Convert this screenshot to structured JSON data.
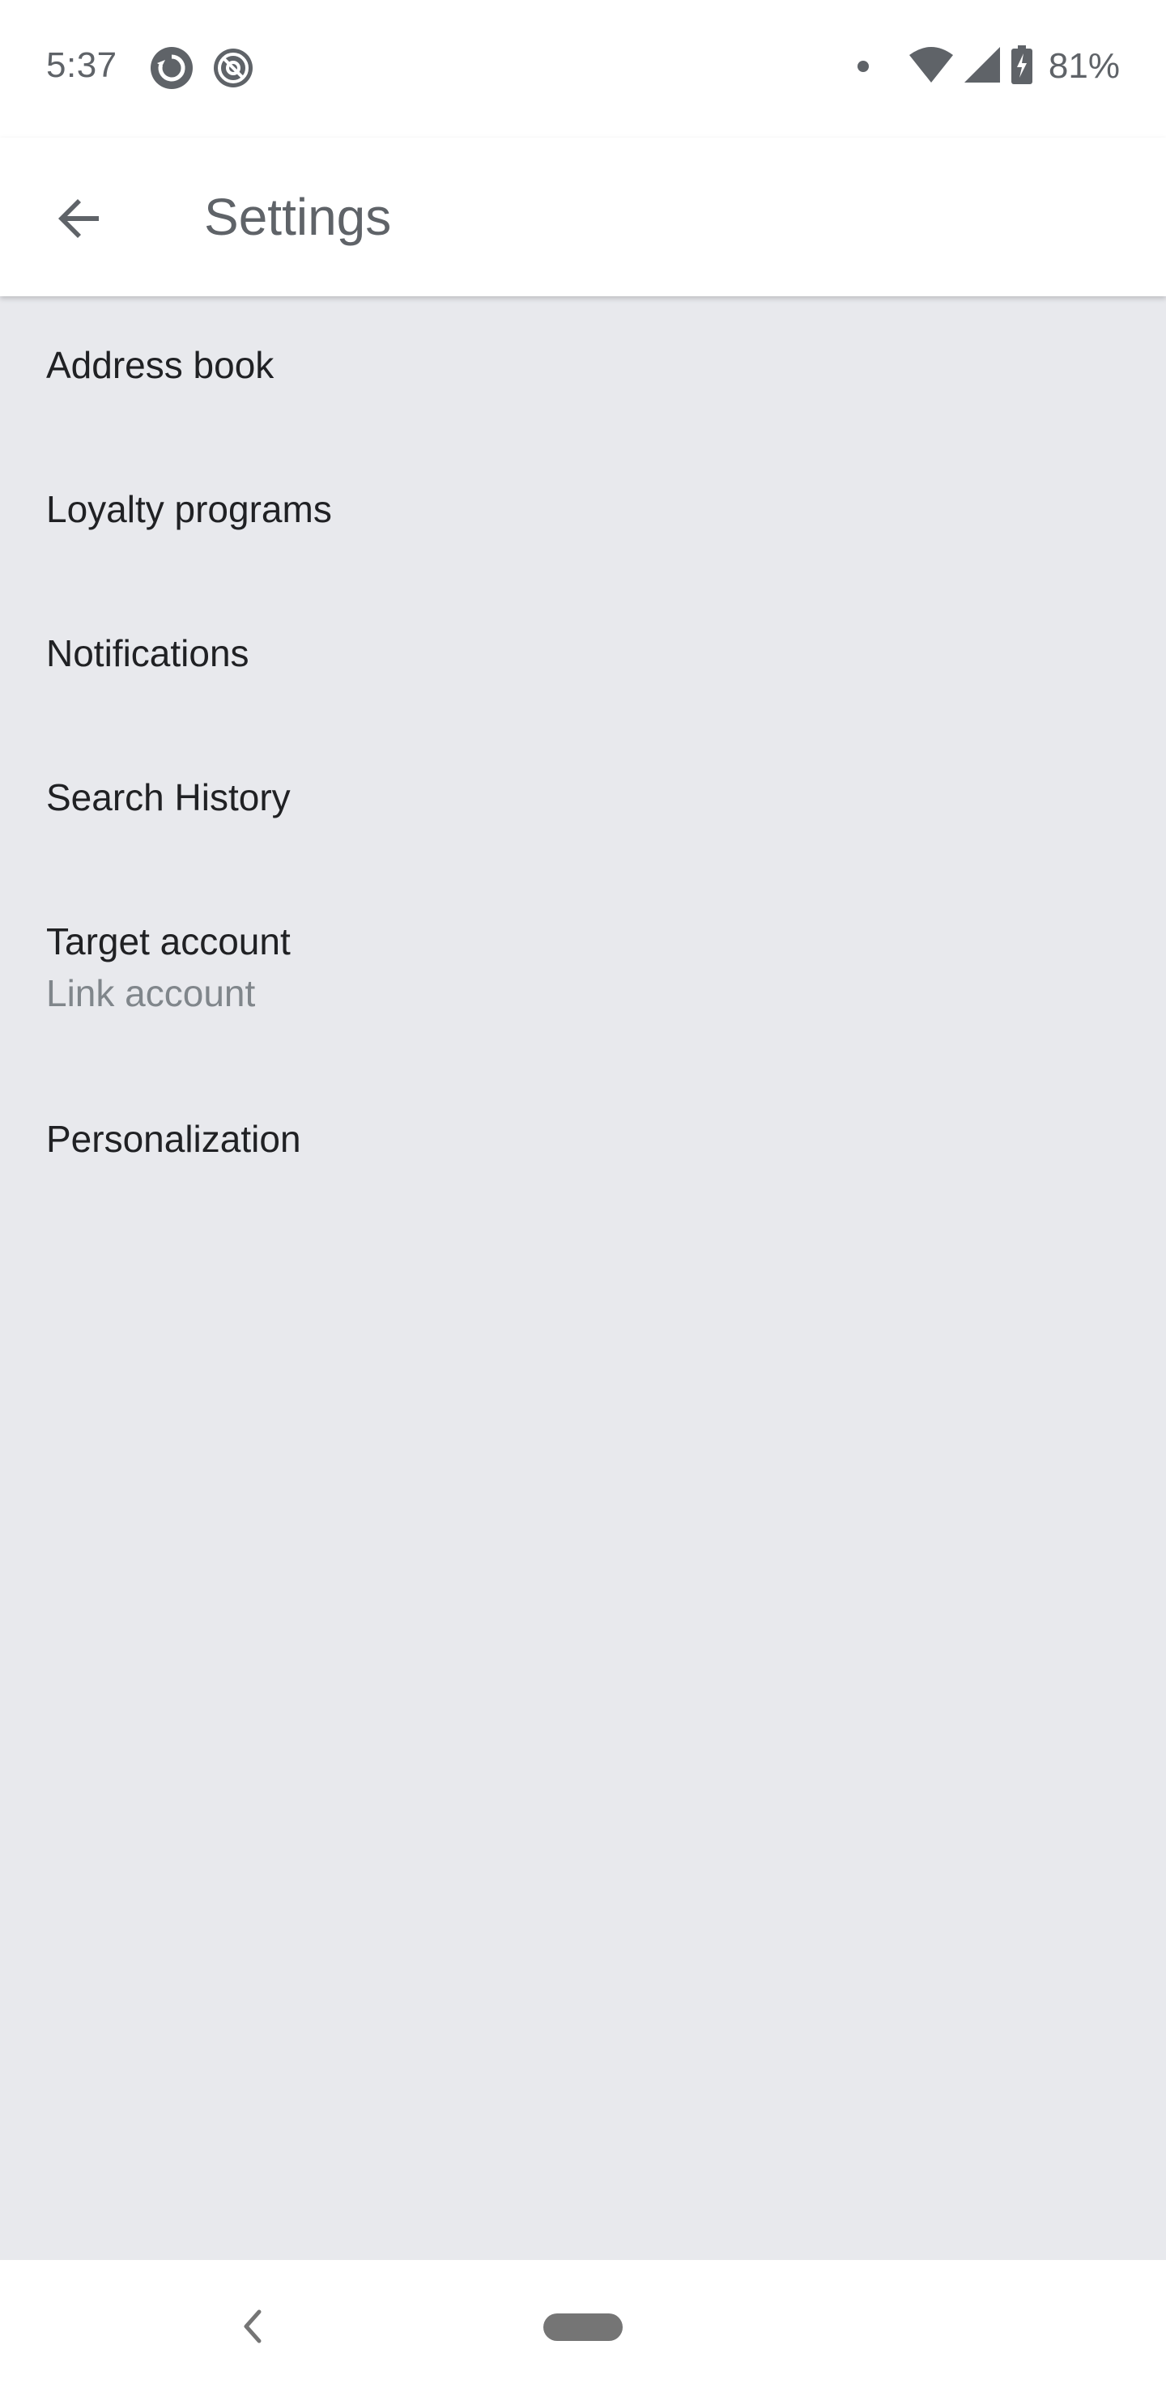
{
  "status_bar": {
    "time": "5:37",
    "notification_icons": [
      "sync-circle-icon",
      "at-sign-circle-icon"
    ],
    "indicators": [
      "dot-icon",
      "wifi-icon",
      "cellular-signal-icon",
      "battery-charging-icon"
    ],
    "battery_percent": "81%"
  },
  "app_bar": {
    "back_icon": "arrow-back-icon",
    "title": "Settings"
  },
  "settings": {
    "items": [
      {
        "label": "Address book"
      },
      {
        "label": "Loyalty programs"
      },
      {
        "label": "Notifications"
      },
      {
        "label": "Search History"
      },
      {
        "label": "Target account",
        "sublabel": "Link account"
      },
      {
        "label": "Personalization"
      }
    ]
  },
  "nav_bar": {
    "back_icon": "chevron-left-icon",
    "home_icon": "home-pill-icon"
  },
  "colors": {
    "background": "#e8e9ed",
    "surface": "#ffffff",
    "primary_text": "#202124",
    "secondary_text": "#80868b",
    "icon_grey": "#5f6368"
  }
}
